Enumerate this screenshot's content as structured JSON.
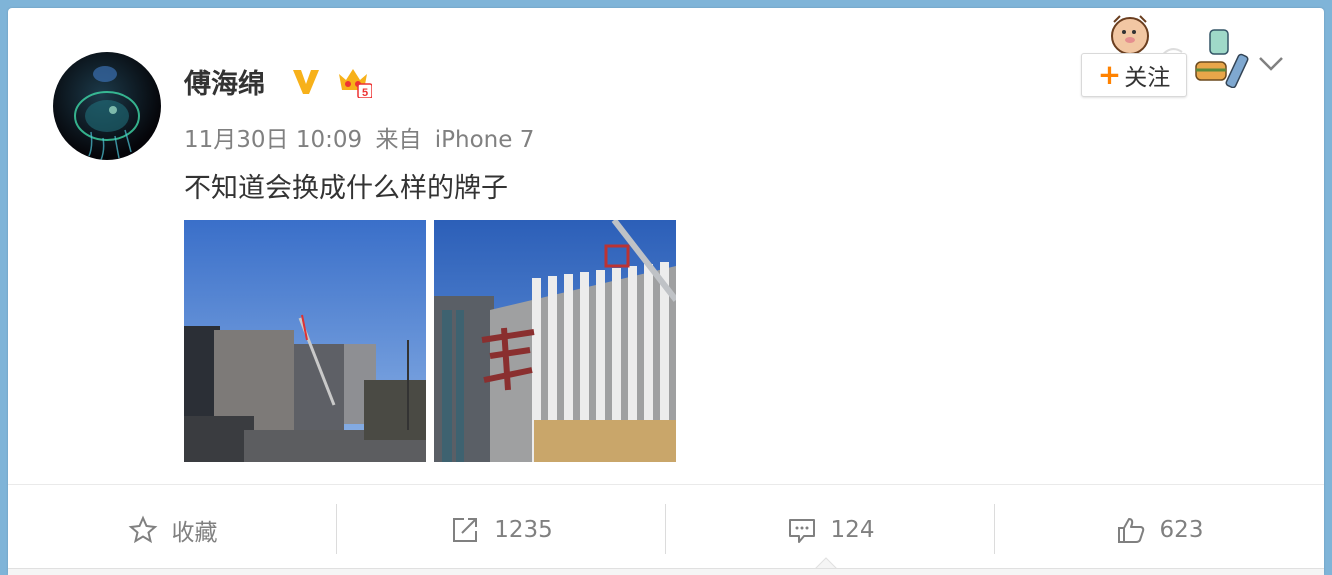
{
  "post": {
    "author": "傅海绵",
    "badges": [
      "verified-v-icon",
      "member-crown-icon"
    ],
    "timestamp": "11月30日 10:09",
    "source_prefix": "来自",
    "source": "iPhone 7",
    "text": "不知道会换成什么样的牌子"
  },
  "follow": {
    "label": "关注"
  },
  "actions": {
    "favorite": {
      "label": "收藏",
      "icon": "star-icon"
    },
    "repost": {
      "count": "1235",
      "icon": "share-icon"
    },
    "comment": {
      "count": "124",
      "icon": "comment-icon"
    },
    "like": {
      "count": "623",
      "icon": "thumbs-up-icon"
    }
  },
  "colors": {
    "accent_orange": "#ff8200",
    "text_primary": "#333333",
    "text_secondary": "#808080",
    "verified_gold": "#f7b11a"
  }
}
